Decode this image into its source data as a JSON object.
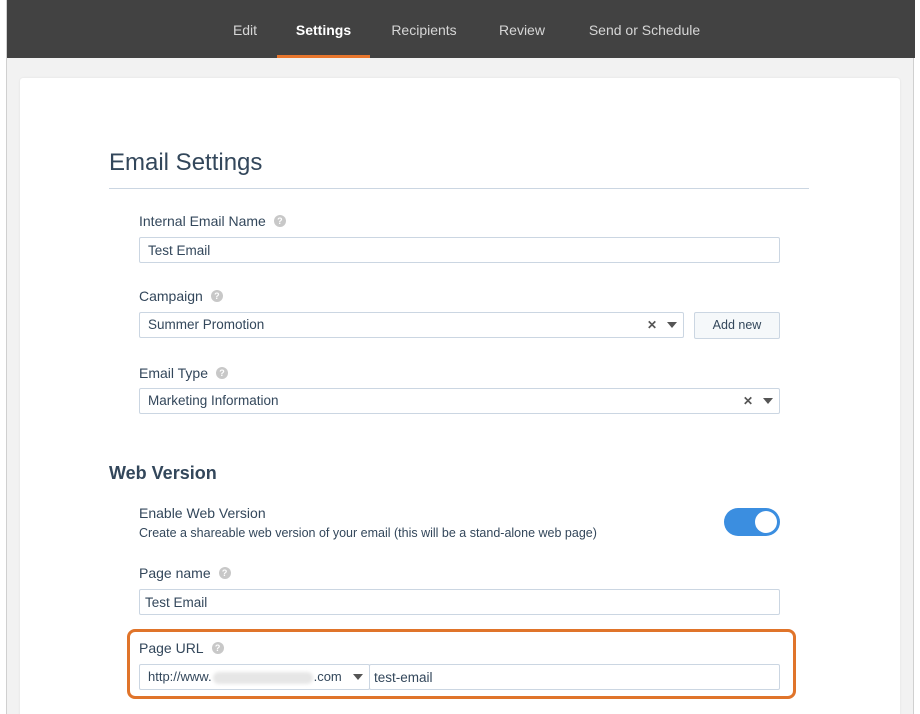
{
  "nav": {
    "tabs": [
      {
        "label": "Edit",
        "active": false
      },
      {
        "label": "Settings",
        "active": true
      },
      {
        "label": "Recipients",
        "active": false
      },
      {
        "label": "Review",
        "active": false
      },
      {
        "label": "Send or Schedule",
        "active": false
      }
    ]
  },
  "page": {
    "title": "Email Settings"
  },
  "fields": {
    "internal_name": {
      "label": "Internal Email Name",
      "value": "Test Email"
    },
    "campaign": {
      "label": "Campaign",
      "value": "Summer Promotion",
      "add_label": "Add new"
    },
    "email_type": {
      "label": "Email Type",
      "value": "Marketing Information"
    }
  },
  "web_version": {
    "title": "Web Version",
    "enable_label": "Enable Web Version",
    "enable_desc": "Create a shareable web version of your email (this will be a stand-alone web page)",
    "enabled": true,
    "page_name": {
      "label": "Page name",
      "value": "Test Email"
    },
    "page_url": {
      "label": "Page URL",
      "domain_prefix": "http://www.",
      "domain_suffix": ".com",
      "slug": "test-email"
    }
  },
  "colors": {
    "accent": "#e8762d",
    "toggle_on": "#3b8ee0",
    "nav_bg": "#424242"
  }
}
